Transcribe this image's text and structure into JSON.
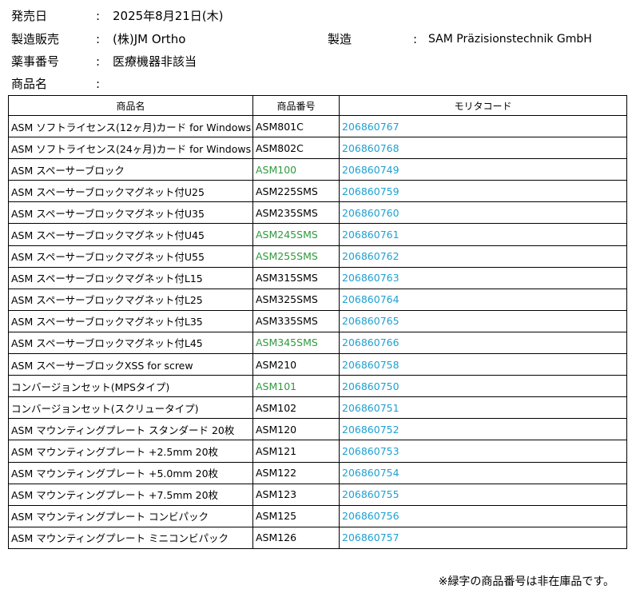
{
  "header": {
    "date_label": "発売日",
    "date_value": "2025年8月21日(木)",
    "sales_label": "製造販売",
    "sales_value": "(株)JM Ortho",
    "maker_label": "製造",
    "maker_value": "SAM Präzisionstechnik GmbH",
    "approval_label": "薬事番号",
    "approval_value": "医療機器非該当",
    "product_label": "商品名",
    "product_value": "",
    "colon": ":"
  },
  "table": {
    "columns": [
      "商品名",
      "商品番号",
      "モリタコード"
    ],
    "rows": [
      {
        "name": "ASM ソフトライセンス(12ヶ月)カード for Windows",
        "code": "ASM801C",
        "morita": "206860767",
        "unavailable": false
      },
      {
        "name": "ASM ソフトライセンス(24ヶ月)カード for Windows",
        "code": "ASM802C",
        "morita": "206860768",
        "unavailable": false
      },
      {
        "name": "ASM スペーサーブロック",
        "code": "ASM100",
        "morita": "206860749",
        "unavailable": true
      },
      {
        "name": "ASM スペーサーブロックマグネット付U25",
        "code": "ASM225SMS",
        "morita": "206860759",
        "unavailable": false
      },
      {
        "name": "ASM スペーサーブロックマグネット付U35",
        "code": "ASM235SMS",
        "morita": "206860760",
        "unavailable": false
      },
      {
        "name": "ASM スペーサーブロックマグネット付U45",
        "code": "ASM245SMS",
        "morita": "206860761",
        "unavailable": true
      },
      {
        "name": "ASM スペーサーブロックマグネット付U55",
        "code": "ASM255SMS",
        "morita": "206860762",
        "unavailable": true
      },
      {
        "name": "ASM スペーサーブロックマグネット付L15",
        "code": "ASM315SMS",
        "morita": "206860763",
        "unavailable": false
      },
      {
        "name": "ASM スペーサーブロックマグネット付L25",
        "code": "ASM325SMS",
        "morita": "206860764",
        "unavailable": false
      },
      {
        "name": "ASM スペーサーブロックマグネット付L35",
        "code": "ASM335SMS",
        "morita": "206860765",
        "unavailable": false
      },
      {
        "name": "ASM スペーサーブロックマグネット付L45",
        "code": "ASM345SMS",
        "morita": "206860766",
        "unavailable": true
      },
      {
        "name": "ASM スペーサーブロックXSS for screw",
        "code": "ASM210",
        "morita": "206860758",
        "unavailable": false
      },
      {
        "name": "コンバージョンセット(MPSタイプ)",
        "code": "ASM101",
        "morita": "206860750",
        "unavailable": true
      },
      {
        "name": "コンバージョンセット(スクリュータイプ)",
        "code": "ASM102",
        "morita": "206860751",
        "unavailable": false
      },
      {
        "name": "ASM マウンティングプレート スタンダード 20枚",
        "code": "ASM120",
        "morita": "206860752",
        "unavailable": false
      },
      {
        "name": "ASM マウンティングプレート +2.5mm 20枚",
        "code": "ASM121",
        "morita": "206860753",
        "unavailable": false
      },
      {
        "name": "ASM マウンティングプレート +5.0mm 20枚",
        "code": "ASM122",
        "morita": "206860754",
        "unavailable": false
      },
      {
        "name": "ASM マウンティングプレート +7.5mm 20枚",
        "code": "ASM123",
        "morita": "206860755",
        "unavailable": false
      },
      {
        "name": "ASM マウンティングプレート コンビパック",
        "code": "ASM125",
        "morita": "206860756",
        "unavailable": false
      },
      {
        "name": "ASM マウンティングプレート ミニコンビパック",
        "code": "ASM126",
        "morita": "206860757",
        "unavailable": false
      }
    ]
  },
  "note": "※緑字の商品番号は非在庫品です。",
  "colors": {
    "unavailable_code": "#2e9b3c",
    "morita_code": "#1ea0d2"
  }
}
